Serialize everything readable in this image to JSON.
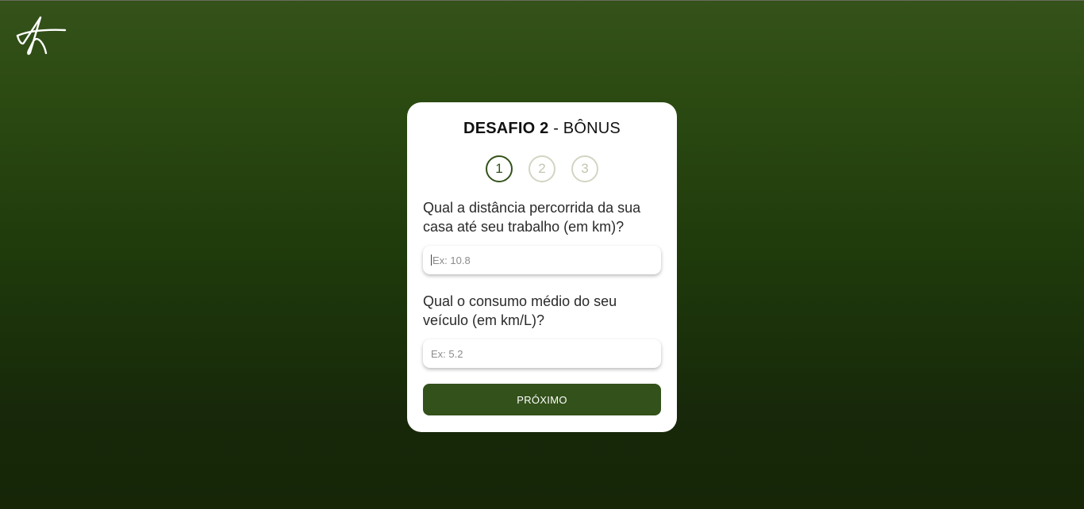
{
  "header": {
    "title_bold": "DESAFIO 2",
    "title_rest": " - BÔNUS"
  },
  "steps": [
    {
      "label": "1",
      "active": true
    },
    {
      "label": "2",
      "active": false
    },
    {
      "label": "3",
      "active": false
    }
  ],
  "questions": [
    {
      "label": "Qual a distância percorrida da sua casa até seu trabalho (em km)?",
      "placeholder": "Ex: 10.8",
      "value": ""
    },
    {
      "label": "Qual o consumo médio do seu veículo (em km/L)?",
      "placeholder": "Ex: 5.2",
      "value": ""
    }
  ],
  "button": {
    "label": "PRÓXIMO"
  },
  "colors": {
    "accent": "#33511a",
    "inactive_step": "#d4d4c3",
    "background_top": "#34521a",
    "background_bottom": "#162607"
  },
  "logo": {
    "icon": "star-signature-logo"
  }
}
